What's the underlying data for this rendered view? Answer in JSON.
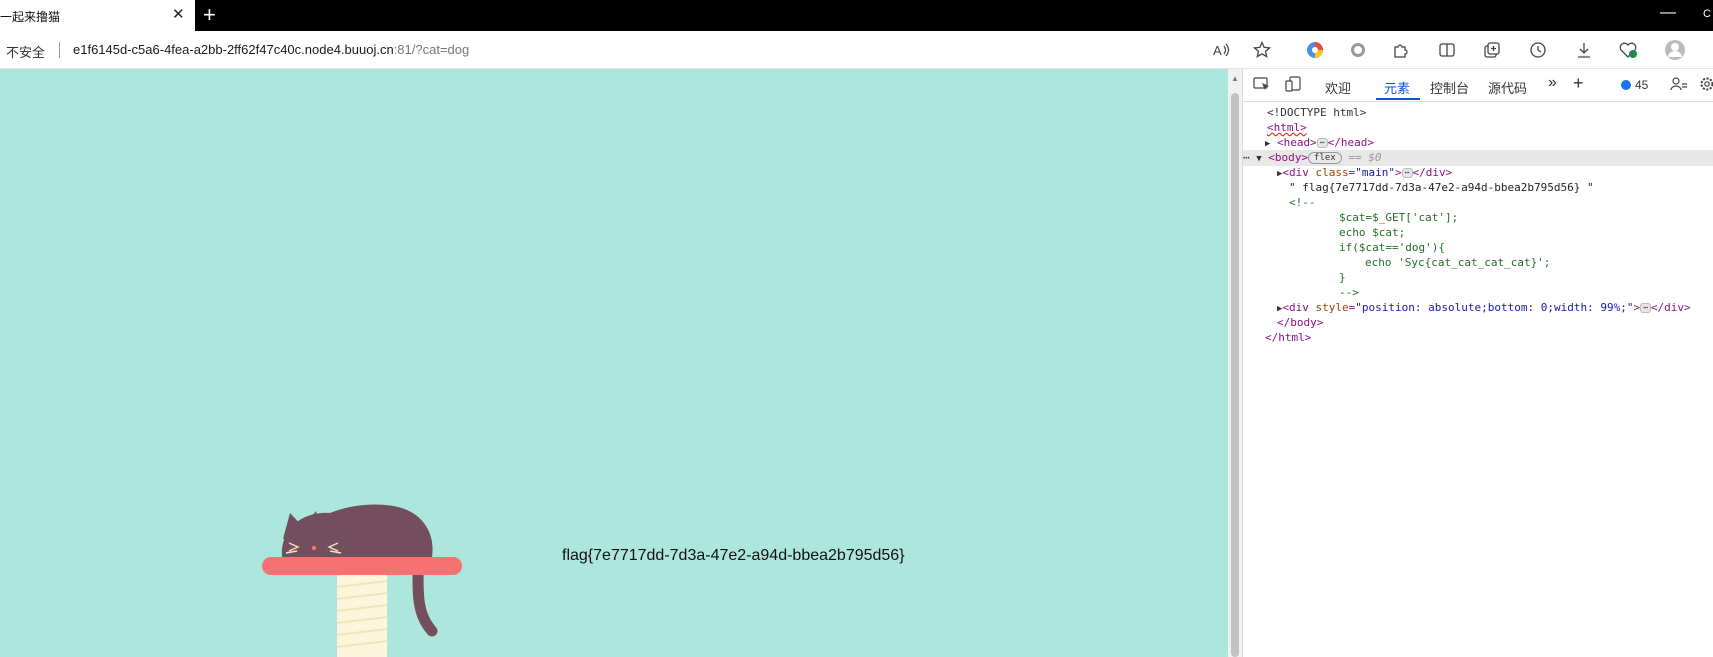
{
  "tab": {
    "title": "一起来撸猫",
    "close": "✕",
    "new_tab": "+"
  },
  "window": {
    "minimize": "—",
    "corner": "C"
  },
  "address_bar": {
    "security": "不安全",
    "url_host": "e1f6145d-c5a6-4fea-a2bb-2ff62f47c40c.node4.buuoj.cn",
    "url_rest": ":81/?cat=dog"
  },
  "page": {
    "flag_text": "flag{7e7717dd-7d3a-47e2-a94d-bbea2b795d56}"
  },
  "devtools": {
    "tabs": {
      "welcome": "欢迎",
      "elements": "元素",
      "console": "控制台",
      "sources": "源代码",
      "more": "»",
      "add": "+"
    },
    "issues_count": "45",
    "dom": {
      "doctype": "<!DOCTYPE html>",
      "html_open": "<html>",
      "head_open": "<head>",
      "head_close": "</head>",
      "body_open": "<body>",
      "flex_badge": "flex",
      "selected_marker": "== $0",
      "div_main_open": "<div ",
      "attr_class": "class",
      "attr_class_value": "\"main\"",
      "div_close": "</div>",
      "text_node": "\" flag{7e7717dd-7d3a-47e2-a94d-bbea2b795d56} \"",
      "comment_open": "<!--",
      "comment_line1": "$cat=$_GET['cat'];",
      "comment_line2": "echo $cat;",
      "comment_line3": "if($cat=='dog'){",
      "comment_line4": "echo 'Syc{cat_cat_cat_cat}';",
      "comment_line5": "}",
      "comment_close": "-->",
      "div_style_open": "<div ",
      "attr_style": "style",
      "attr_style_value": "\"position: absolute;bottom: 0;width: 99%;\"",
      "body_close": "</body>",
      "html_close": "</html>",
      "ellipsis": "⋯"
    }
  },
  "colors": {
    "page_bg": "#ade6dc",
    "cat": "#734f5d",
    "shelf": "#f57272",
    "post": "#fdf6dc"
  }
}
